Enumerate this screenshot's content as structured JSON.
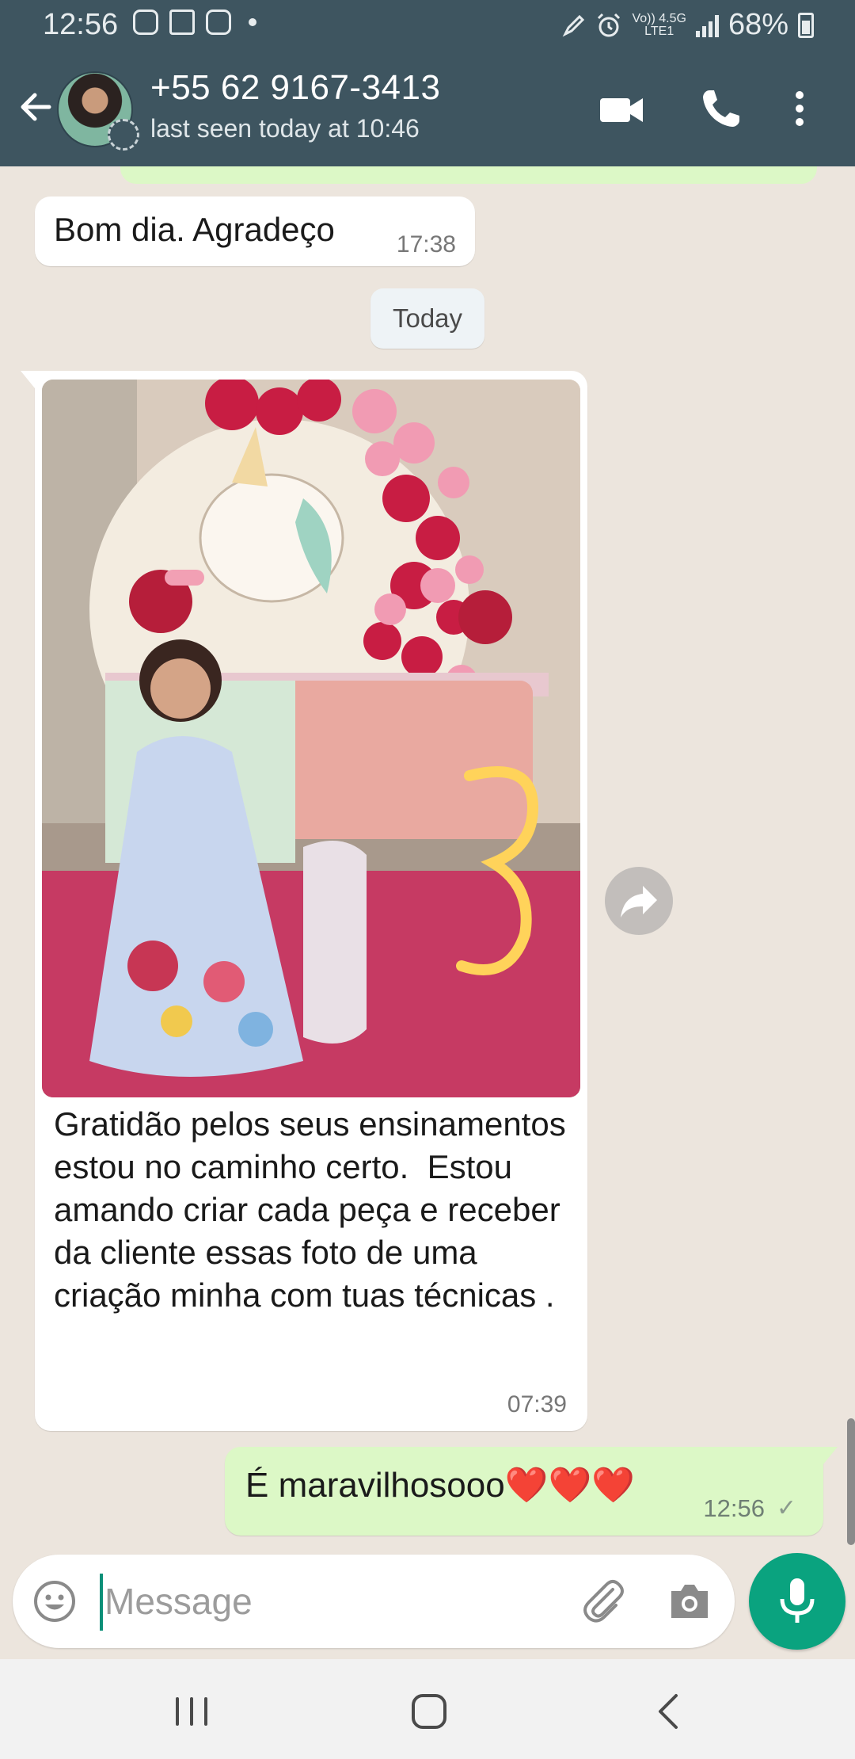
{
  "status_bar": {
    "time": "12:56",
    "network_top": "Vo)) 4.5G",
    "network_bottom": "LTE1",
    "battery": "68%",
    "battery_level": 0.68
  },
  "header": {
    "contact_name": "+55 62 9167-3413",
    "last_seen": "last seen today at 10:46"
  },
  "messages": [
    {
      "direction": "in",
      "text": "Bom dia. Agradeço",
      "time": "17:38"
    },
    {
      "direction": "in",
      "type": "photo",
      "caption": "Gratidão pelos seus ensinamentos estou no caminho certo.  Estou amando criar cada peça e receber da cliente essas foto de uma criação minha com tuas técnicas .",
      "time": "07:39"
    },
    {
      "direction": "out",
      "text": "É maravilhosooo❤️❤️❤️",
      "time": "12:56",
      "status": "✓"
    }
  ],
  "date_divider": "Today",
  "composer": {
    "placeholder": "Message"
  },
  "colors": {
    "header": "#3e5560",
    "outgoing_bubble": "#dcf8c6",
    "chat_background": "#ece5dd",
    "accent": "#0aa37f"
  },
  "icons": [
    "back-arrow-icon",
    "video-call-icon",
    "phone-icon",
    "more-vert-icon",
    "forward-icon",
    "emoji-icon",
    "attach-icon",
    "camera-icon",
    "mic-icon",
    "recents-icon",
    "home-icon",
    "nav-back-icon"
  ]
}
